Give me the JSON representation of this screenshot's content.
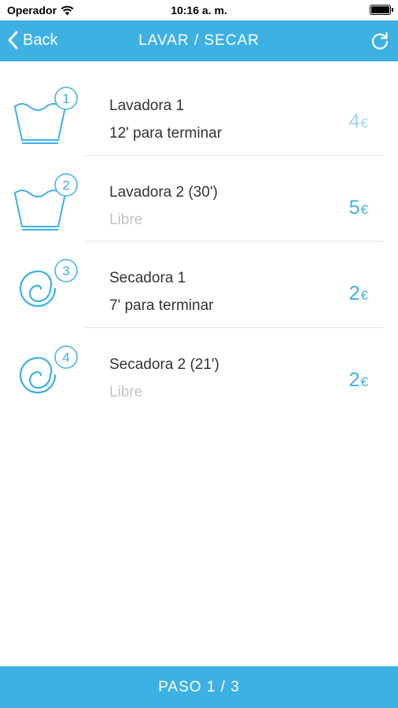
{
  "status_bar": {
    "carrier": "Operador",
    "time": "10:16 a. m.",
    "icons": [
      "wifi-icon",
      "battery-icon"
    ]
  },
  "nav": {
    "back_label": "Back",
    "title": "LAVAR / SECAR",
    "icons": [
      "chevron-left-icon",
      "refresh-icon"
    ]
  },
  "colors": {
    "accent": "#3eb1e3",
    "price_faded": "#9fd4ee",
    "free_text": "#c4c4c4"
  },
  "machines": [
    {
      "number": "1",
      "name": "Lavadora 1",
      "status": "12' para terminar",
      "price": "4",
      "currency": "€",
      "icon": "washing-tub-icon"
    },
    {
      "number": "2",
      "name": "Lavadora 2 (30')",
      "status": "Libre",
      "price": "5",
      "currency": "€",
      "icon": "washing-tub-icon"
    },
    {
      "number": "3",
      "name": "Secadora 1",
      "status": "7' para terminar",
      "price": "2",
      "currency": "€",
      "icon": "dryer-spiral-icon"
    },
    {
      "number": "4",
      "name": "Secadora 2 (21')",
      "status": "Libre",
      "price": "2",
      "currency": "€",
      "icon": "dryer-spiral-icon"
    }
  ],
  "footer": {
    "label": "PASO 1 / 3"
  }
}
